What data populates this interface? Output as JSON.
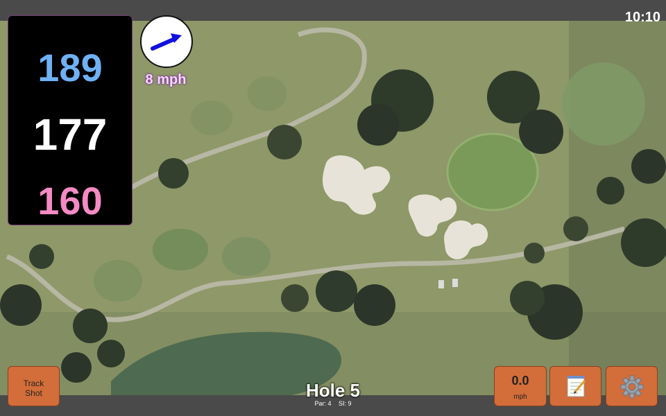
{
  "status_bar": {
    "time": "10:10"
  },
  "distances": {
    "back": "189",
    "middle": "177",
    "front": "160"
  },
  "wind": {
    "speed": "8 mph",
    "direction_icon": "arrow-icon"
  },
  "hole": {
    "title": "Hole 5",
    "par": "Par: 4",
    "stroke_index": "SI: 9"
  },
  "buttons": {
    "track_shot_line1": "Track",
    "track_shot_line2": "Shot",
    "speed_value": "0.0",
    "speed_unit": "mph",
    "notes_icon": "notepad-icon",
    "settings_icon": "gear-icon"
  },
  "colors": {
    "back_distance": "#6fb1f5",
    "middle_distance": "#ffffff",
    "front_distance": "#f58ac4",
    "button": "#d36d3a",
    "wind_arrow": "#1010e0"
  }
}
